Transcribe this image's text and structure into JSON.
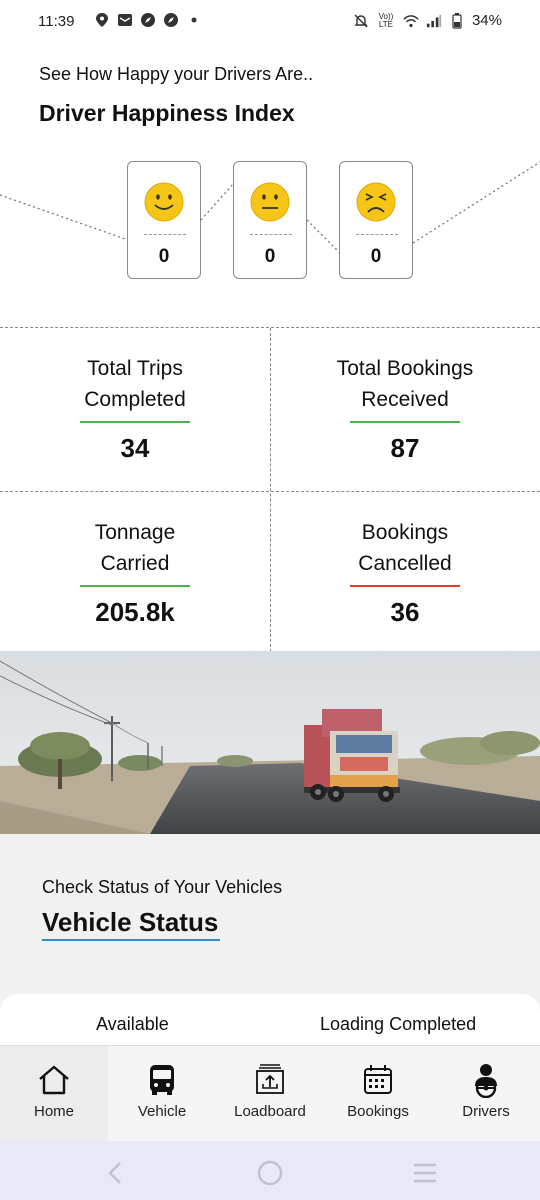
{
  "status_bar": {
    "time": "11:39",
    "battery": "34%",
    "network": "Vo)) LTE"
  },
  "header": {
    "subtitle": "See How Happy your Drivers Are..",
    "title": "Driver Happiness Index"
  },
  "happiness": [
    {
      "mood": "happy",
      "icon": "happy-face-icon",
      "count": "0"
    },
    {
      "mood": "neutral",
      "icon": "neutral-face-icon",
      "count": "0"
    },
    {
      "mood": "sad",
      "icon": "sad-face-icon",
      "count": "0"
    }
  ],
  "stats": [
    {
      "label_line1": "Total Trips",
      "label_line2": "Completed",
      "value": "34",
      "accent": "#4caf50"
    },
    {
      "label_line1": "Total Bookings",
      "label_line2": "Received",
      "value": "87",
      "accent": "#4caf50"
    },
    {
      "label_line1": "Tonnage",
      "label_line2": "Carried",
      "value": "205.8k",
      "accent": "#4caf50"
    },
    {
      "label_line1": "Bookings",
      "label_line2": "Cancelled",
      "value": "36",
      "accent": "#e53935"
    }
  ],
  "vehicle_status": {
    "subtitle": "Check Status of Your Vehicles",
    "title": "Vehicle Status",
    "tabs": [
      "Available",
      "Loading Completed"
    ]
  },
  "bottom_nav": [
    {
      "label": "Home",
      "icon": "home-icon",
      "active": true
    },
    {
      "label": "Vehicle",
      "icon": "bus-icon",
      "active": false
    },
    {
      "label": "Loadboard",
      "icon": "loadboard-icon",
      "active": false
    },
    {
      "label": "Bookings",
      "icon": "calendar-icon",
      "active": false
    },
    {
      "label": "Drivers",
      "icon": "driver-icon",
      "active": false
    }
  ],
  "colors": {
    "happy_yellow": "#f5c518",
    "accent_green": "#4caf50",
    "accent_red": "#e53935",
    "accent_blue": "#2f8fd6"
  }
}
